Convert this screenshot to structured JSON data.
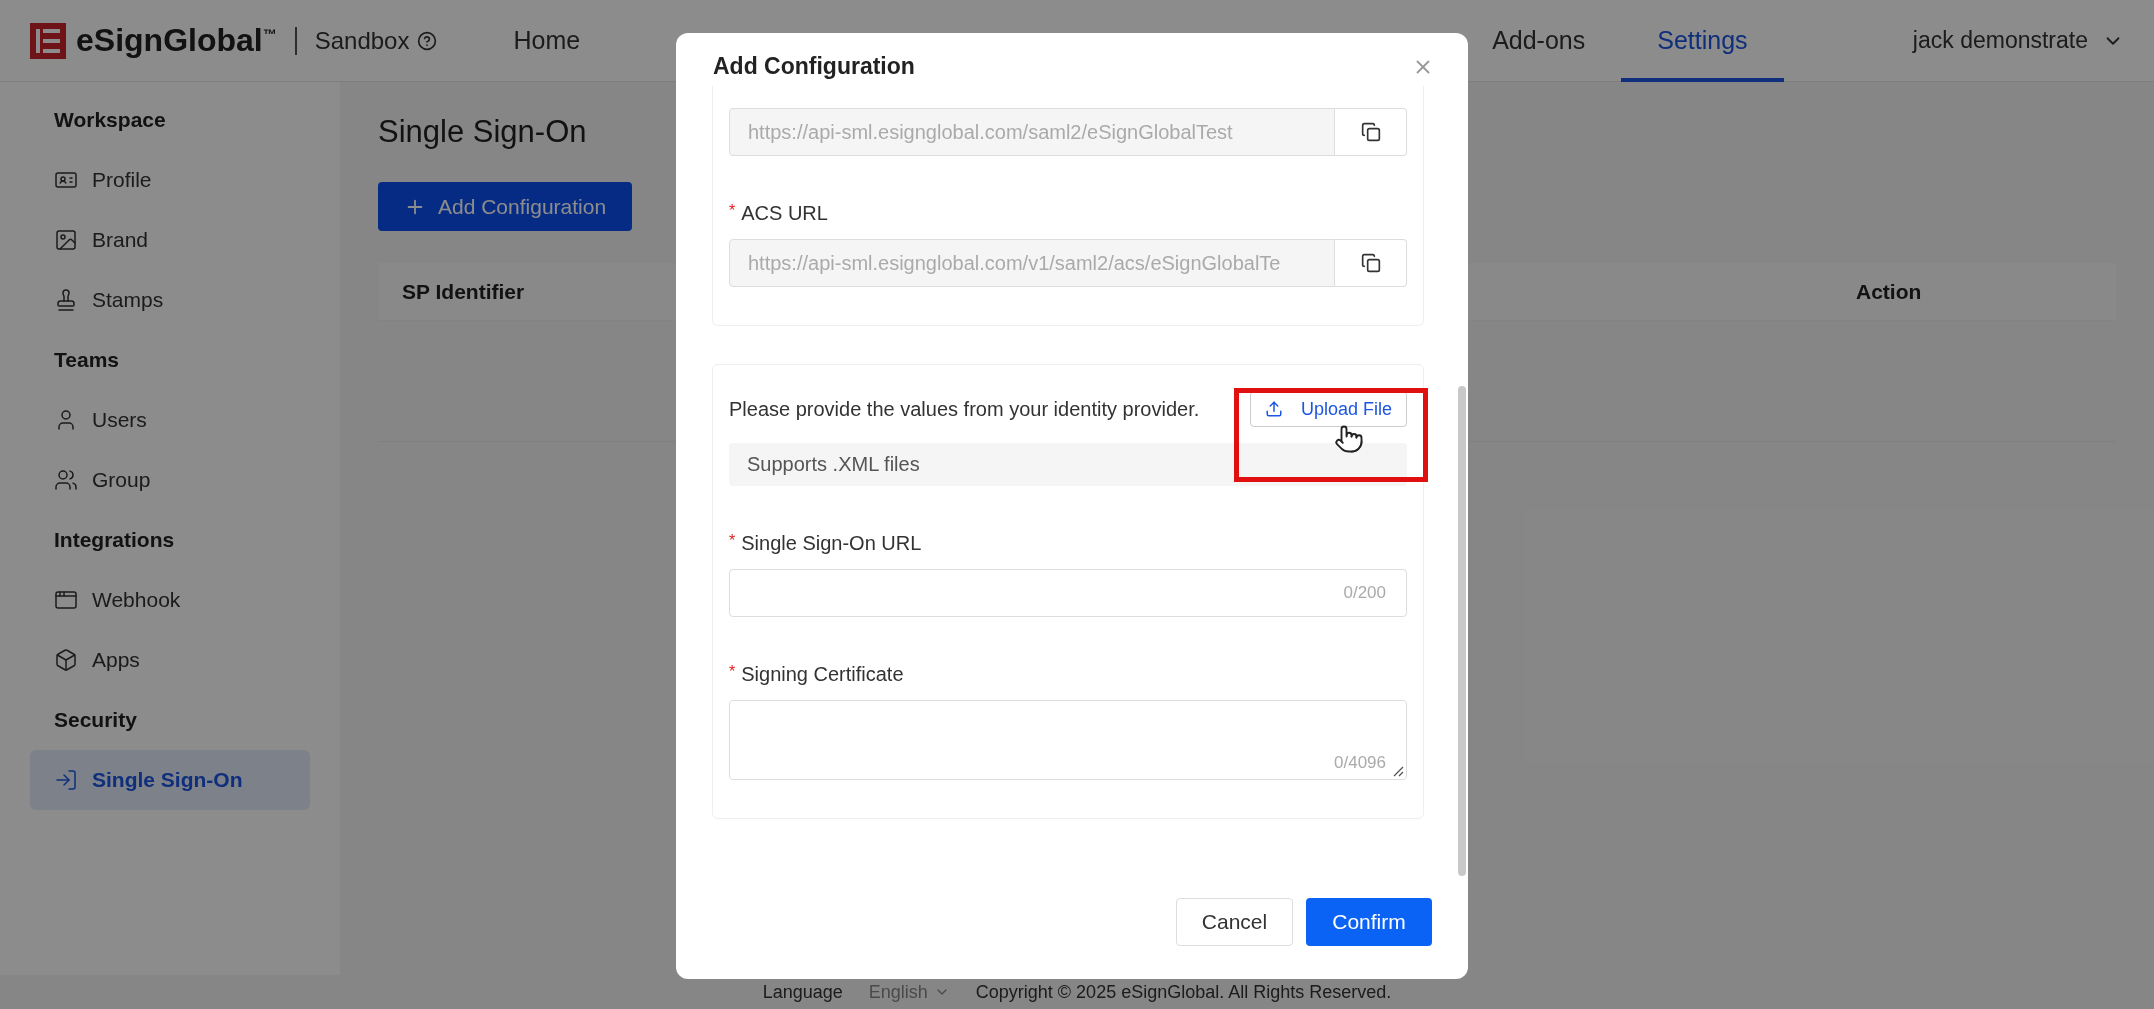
{
  "header": {
    "brand": "eSignGlobal$^{™}$",
    "environment": "Sandbox",
    "nav": [
      {
        "label": "Home",
        "selected": false
      },
      {
        "label": "Add-ons",
        "selected": false
      },
      {
        "label": "Settings",
        "selected": true
      }
    ],
    "user": "jack demonstrate"
  },
  "sidebar": {
    "sections": [
      {
        "title": "Workspace",
        "items": [
          {
            "label": "Profile",
            "selected": false
          },
          {
            "label": "Brand",
            "selected": false
          },
          {
            "label": "Stamps",
            "selected": false
          }
        ]
      },
      {
        "title": "Teams",
        "items": [
          {
            "label": "Users",
            "selected": false
          },
          {
            "label": "Group",
            "selected": false
          }
        ]
      },
      {
        "title": "Integrations",
        "items": [
          {
            "label": "Webhook",
            "selected": false
          },
          {
            "label": "Apps",
            "selected": false
          }
        ]
      },
      {
        "title": "Security",
        "items": [
          {
            "label": "Single Sign-On",
            "selected": true
          }
        ]
      }
    ]
  },
  "main": {
    "title": "Single Sign-On",
    "add_button": "Add Configuration",
    "table": {
      "columns": [
        "SP Identifier",
        "Action"
      ]
    }
  },
  "modal": {
    "title": "Add Configuration",
    "sp_fields": [
      {
        "value": "https://api-sml.esignglobal.com/saml2/eSignGlobalTest"
      },
      {
        "label": "ACS URL",
        "required_mark": "*",
        "value": "https://api-sml.esignglobal.com/v1/saml2/acs/eSignGlobalTe"
      }
    ],
    "idp": {
      "instruction": "Please provide the values from your identity provider.",
      "upload_button": "Upload File",
      "hint": "Supports .XML files",
      "fields": [
        {
          "kind": "input",
          "label": "Single Sign-On URL",
          "required_mark": "*",
          "counter": "0/200"
        },
        {
          "kind": "textarea",
          "label": "Signing Certificate",
          "required_mark": "*",
          "counter": "0/4096"
        }
      ]
    },
    "cancel": "Cancel",
    "confirm": "Confirm"
  },
  "footer": {
    "language_label": "Language",
    "language": "English",
    "copyright": "Copyright © 2025 eSignGlobal. All Rights Reserved."
  }
}
